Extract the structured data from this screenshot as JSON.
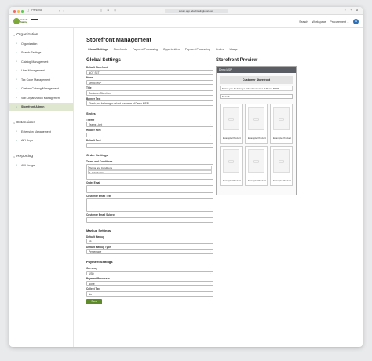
{
  "browser": {
    "profile": "Personal",
    "url": "saturn.app.adachisalinglocal.com"
  },
  "header": {
    "logo_text": [
      "Adachi",
      "Sailing"
    ],
    "logo2_text": "",
    "search": "Search",
    "workspace": "Workspace",
    "procurement": "Procurement",
    "avatar": "JN"
  },
  "sidebar": {
    "sections": [
      {
        "title": "Organization",
        "items": [
          "Organization",
          "Search Settings",
          "Catalog Management",
          "User Management",
          "Tax Code Management",
          "Custom Catalog Management",
          "Sub Organization Management",
          "Storefront Admin"
        ]
      },
      {
        "title": "Extensions",
        "items": [
          "Extension Management",
          "API Keys"
        ]
      },
      {
        "title": "Reporting",
        "items": [
          "API Usage"
        ]
      }
    ],
    "active": "Storefront Admin"
  },
  "main": {
    "title": "Storefront Management",
    "tabs": [
      "Global Settings",
      "Storefronts",
      "Payment Processing",
      "Opportunities",
      "Payment Processing",
      "Orders",
      "Usage"
    ],
    "active_tab": "Global Settings"
  },
  "form": {
    "title": "Global Settings",
    "default_storefront_label": "Default Storefront",
    "default_storefront_value": "NOT SET",
    "name_label": "Name",
    "name_value": "Demo MSP",
    "title_label": "Title",
    "title_value": "Customer Storefront",
    "banner_label": "Banner Text",
    "banner_value": "Thank you for being a valued customer of Demo MSP!",
    "styles_heading": "Styles",
    "theme_label": "Theme",
    "theme_value": "Teams Light",
    "header_font_label": "Header Font",
    "header_font_value": "",
    "default_font_label": "Default Font",
    "default_font_value": "",
    "order_heading": "Order Settings",
    "terms_label": "Terms and Conditions",
    "terms_lines": [
      "Terms and Conditions",
      "1. Introduction"
    ],
    "order_email_label": "Order Email",
    "customer_email_text_label": "Customer Email Text",
    "customer_email_subject_label": "Customer Email Subject",
    "markup_heading": "Markup Settings",
    "default_markup_label": "Default Markup",
    "default_markup_value": "25",
    "markup_type_label": "Default Markup Type",
    "markup_type_value": "Percentage",
    "payment_heading": "Payment Settings",
    "currency_label": "Currency",
    "currency_value": "USD",
    "processor_label": "Payment Processor",
    "processor_value": "None",
    "collect_tax_label": "Collect Tax",
    "collect_tax_value": "No",
    "save_label": "Save"
  },
  "preview": {
    "title": "Storefront Preview",
    "bar_text": "Demo MSP",
    "store_header": "Customer Storefront",
    "banner": "Thank you for being a valued customer of Demo MSP!",
    "search_placeholder": "Search",
    "products": [
      "Example Product",
      "Example Product",
      "Example Product",
      "Example Product",
      "Example Product",
      "Example Product"
    ]
  },
  "colors": {
    "accent": "#5f8b2d",
    "active_sidebar": "#dfe7d0",
    "avatar": "#2f6fb3"
  }
}
